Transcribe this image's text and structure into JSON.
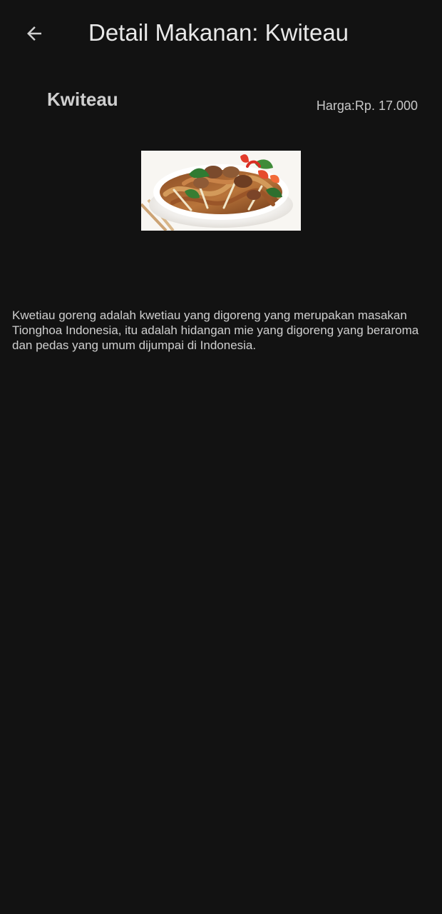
{
  "header": {
    "title": "Detail Makanan: Kwiteau",
    "back_icon": "arrow-left-icon"
  },
  "food": {
    "name": "Kwiteau",
    "price": "Harga:Rp. 17.000",
    "image_subject": "kwetiau goreng dish",
    "description": "Kwetiau goreng adalah kwetiau yang digoreng yang merupakan masakan Tionghoa Indonesia, itu adalah hidangan mie yang digoreng yang beraroma dan pedas yang umum dijumpai di Indonesia."
  },
  "theme": {
    "background": "#121212",
    "text": "#e6e6e6",
    "muted_text": "#c8c8c8"
  }
}
